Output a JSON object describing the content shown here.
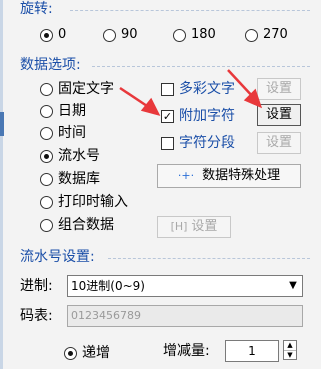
{
  "rotation": {
    "title": "旋转:",
    "options": [
      {
        "label": "0",
        "selected": true
      },
      {
        "label": "90",
        "selected": false
      },
      {
        "label": "180",
        "selected": false
      },
      {
        "label": "270",
        "selected": false
      }
    ]
  },
  "data_options": {
    "title": "数据选项:",
    "types": [
      {
        "label": "固定文字",
        "selected": false
      },
      {
        "label": "日期",
        "selected": false
      },
      {
        "label": "时间",
        "selected": false
      },
      {
        "label": "流水号",
        "selected": true
      },
      {
        "label": "数据库",
        "selected": false
      },
      {
        "label": "打印时输入",
        "selected": false
      },
      {
        "label": "组合数据",
        "selected": false
      }
    ],
    "multicolor": {
      "label": "多彩文字",
      "checked": false,
      "button": "设置",
      "button_enabled": false
    },
    "append_chars": {
      "label": "附加字符",
      "checked": true,
      "check_mark": "✓",
      "button": "设置",
      "button_enabled": true
    },
    "segment": {
      "label": "字符分段",
      "checked": false,
      "button": "设置",
      "button_enabled": false
    },
    "special_button": {
      "label": "数据特殊处理",
      "icon": "dots-icon",
      "icon_glyph": "·+·"
    },
    "combo_button": {
      "label": "设置",
      "icon": "brackets-icon",
      "icon_glyph": "[H]"
    }
  },
  "serial": {
    "title": "流水号设置:",
    "base_label": "进制:",
    "base_value": "10进制(0~9)",
    "code_label": "码表:",
    "code_value": "0123456789",
    "increment": {
      "label": "递增",
      "selected": true
    },
    "step_label": "增减量:",
    "step_value": "1"
  },
  "colors": {
    "accent": "#1b4fa8",
    "arrow": "#e8383b"
  }
}
